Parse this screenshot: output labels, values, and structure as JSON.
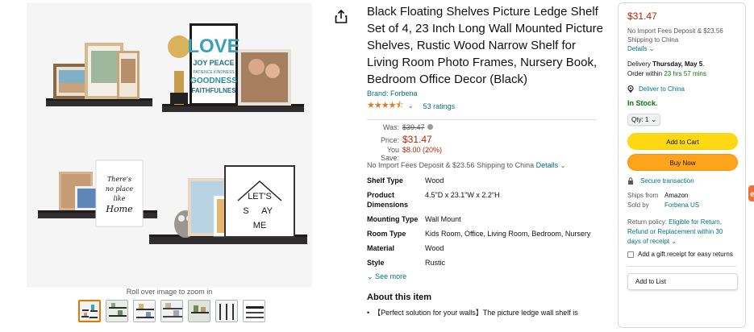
{
  "gallery": {
    "zoom_hint": "Roll over image to zoom in",
    "thumbnails": [
      "thumb-1",
      "thumb-2",
      "thumb-3",
      "thumb-4",
      "thumb-5",
      "thumb-6",
      "thumb-7"
    ],
    "artwork": {
      "love_big": "LOVE",
      "love_lines": [
        "JOY PEACE",
        "PATIENCE KINDNESS",
        "GOODNESS",
        "FAITHFULNES"
      ],
      "heres_no_place": [
        "There's",
        "no place",
        "like",
        "Home"
      ],
      "lets_stay_home": [
        "LET'S",
        "S",
        "AY",
        "ME"
      ]
    }
  },
  "product": {
    "title": "Black Floating Shelves Picture Ledge Shelf Set of 4, 23 Inch Long Wall Mounted Picture Shelves, Rustic Wood Narrow Shelf for Living Room Photo Frames, Nursery Book, Bedroom Office Decor (Black)",
    "brand": "Brand: Forbena",
    "stars": "★★★★⯪",
    "ratings": "53 ratings",
    "was_label": "Was:",
    "was_price": "$39.47",
    "price_label": "Price:",
    "price": "$31.47",
    "save_label": "You Save:",
    "save_value": "$8.00 (20%)",
    "import_line": "No Import Fees Deposit & $23.56 Shipping to China",
    "details_link": "Details",
    "specs": [
      {
        "key": "Shelf Type",
        "value": "Wood"
      },
      {
        "key": "Product Dimensions",
        "value": "4.5\"D x 23.1\"W x 2.2\"H"
      },
      {
        "key": "Mounting Type",
        "value": "Wall Mount"
      },
      {
        "key": "Room Type",
        "value": "Kids Room, Office, Living Room, Bedroom, Nursery"
      },
      {
        "key": "Material",
        "value": "Wood"
      },
      {
        "key": "Style",
        "value": "Rustic"
      }
    ],
    "see_more": "See more",
    "about_title": "About this item",
    "about_bullet_1": "【Perfect solution for your walls】The picture ledge wall shelf is"
  },
  "buybox": {
    "price": "$31.47",
    "import_note": "No Import Fees Deposit & $23.56 Shipping to China",
    "details": "Details",
    "delivery_prefix": "Delivery",
    "delivery_date": "Thursday, May 5",
    "order_within_prefix": "Order within",
    "order_within_time": "23 hrs 57 mins",
    "deliver_to": "Deliver to China",
    "in_stock": "In Stock.",
    "qty_label": "Qty: 1",
    "add_to_cart": "Add to Cart",
    "buy_now": "Buy Now",
    "secure": "Secure transaction",
    "ships_from_label": "Ships from",
    "ships_from_value": "Amazon",
    "sold_by_label": "Sold by",
    "sold_by_value": "Forbena US",
    "return_policy_prefix": "Return policy:",
    "return_policy_link": "Eligible for Return, Refund or Replacement within 30 days of receipt",
    "gift_receipt": "Add a gift receipt for easy returns",
    "add_to_list": "Add to List"
  },
  "colors": {
    "price_red": "#b12704",
    "link_teal": "#007185",
    "cart_yellow": "#ffd814",
    "buy_orange": "#ffa41c",
    "stock_green": "#007600"
  }
}
